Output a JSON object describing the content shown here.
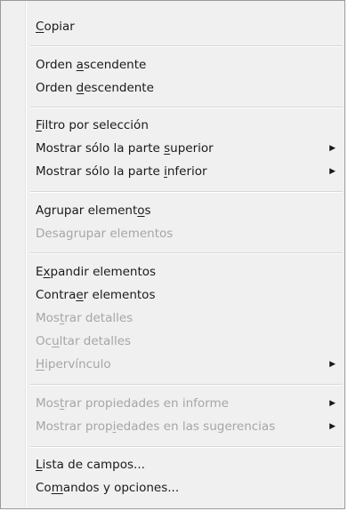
{
  "menu": {
    "items": [
      {
        "pre": "",
        "key": "C",
        "post": "opiar",
        "disabled": false,
        "submenu": false
      },
      {
        "pre": "Orden ",
        "key": "a",
        "post": "scendente",
        "disabled": false,
        "submenu": false
      },
      {
        "pre": "Orden ",
        "key": "d",
        "post": "escendente",
        "disabled": false,
        "submenu": false
      },
      {
        "pre": "",
        "key": "F",
        "post": "iltro por selección",
        "disabled": false,
        "submenu": false
      },
      {
        "pre": "Mostrar sólo la parte ",
        "key": "s",
        "post": "uperior",
        "disabled": false,
        "submenu": true
      },
      {
        "pre": "Mostrar sólo la parte ",
        "key": "i",
        "post": "nferior",
        "disabled": false,
        "submenu": true
      },
      {
        "pre": "Agrupar element",
        "key": "o",
        "post": "s",
        "disabled": false,
        "submenu": false
      },
      {
        "pre": "Desagrupar elementos",
        "key": "",
        "post": "",
        "disabled": true,
        "submenu": false
      },
      {
        "pre": "E",
        "key": "x",
        "post": "pandir elementos",
        "disabled": false,
        "submenu": false
      },
      {
        "pre": "Contra",
        "key": "e",
        "post": "r elementos",
        "disabled": false,
        "submenu": false
      },
      {
        "pre": "Mos",
        "key": "t",
        "post": "rar detalles",
        "disabled": true,
        "submenu": false
      },
      {
        "pre": "Oc",
        "key": "u",
        "post": "ltar detalles",
        "disabled": true,
        "submenu": false
      },
      {
        "pre": "",
        "key": "H",
        "post": "ipervínculo",
        "disabled": true,
        "submenu": true
      },
      {
        "pre": "Mos",
        "key": "t",
        "post": "rar propiedades en informe",
        "disabled": true,
        "submenu": true
      },
      {
        "pre": "Mostrar prop",
        "key": "i",
        "post": "edades en las sugerencias",
        "disabled": true,
        "submenu": true
      },
      {
        "pre": "",
        "key": "L",
        "post": "ista de campos...",
        "disabled": false,
        "submenu": false
      },
      {
        "pre": "Co",
        "key": "m",
        "post": "andos y opciones...",
        "disabled": false,
        "submenu": false
      }
    ],
    "submenu_arrow": "▶"
  }
}
